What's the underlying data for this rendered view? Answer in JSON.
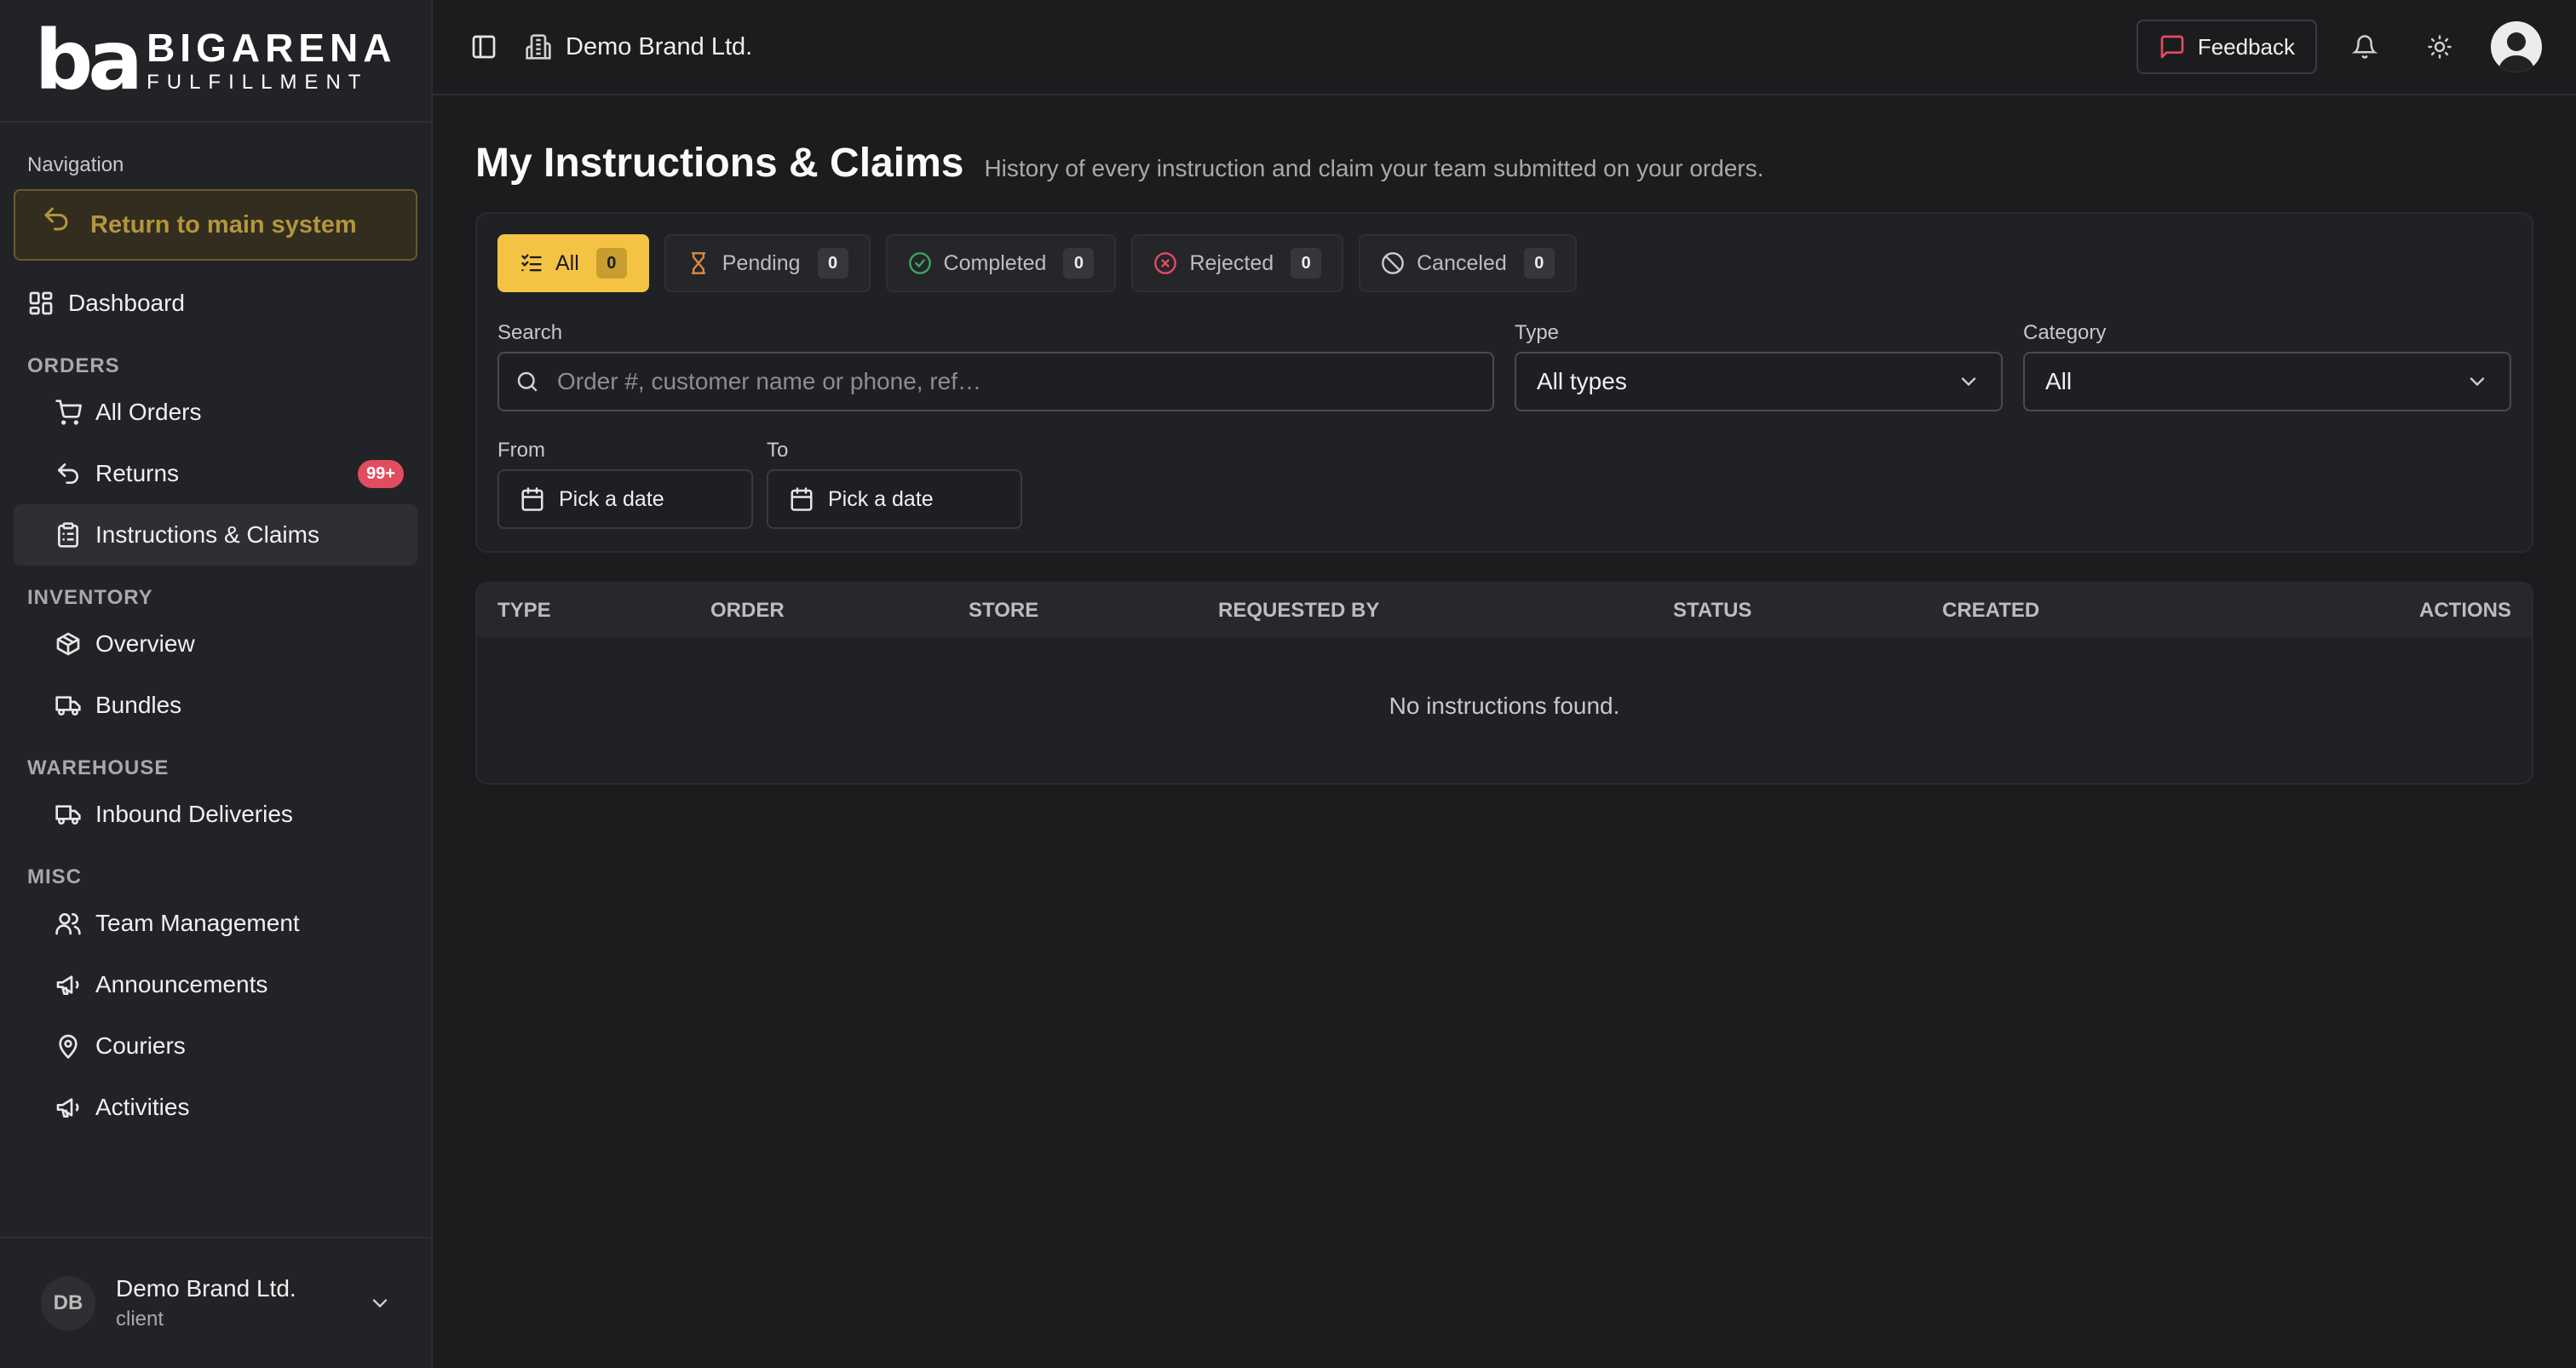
{
  "logo": {
    "mark": "ba",
    "main": "BIGARENA",
    "sub": "FULFILLMENT"
  },
  "sidebar": {
    "nav_label": "Navigation",
    "return_label": "Return to main system",
    "dashboard": "Dashboard",
    "sections": {
      "orders": "ORDERS",
      "inventory": "INVENTORY",
      "warehouse": "WAREHOUSE",
      "misc": "MISC"
    },
    "orders_items": [
      {
        "label": "All Orders"
      },
      {
        "label": "Returns",
        "badge": "99+"
      },
      {
        "label": "Instructions & Claims"
      }
    ],
    "inventory_items": [
      {
        "label": "Overview"
      },
      {
        "label": "Bundles"
      }
    ],
    "warehouse_items": [
      {
        "label": "Inbound Deliveries"
      }
    ],
    "misc_items": [
      {
        "label": "Team Management"
      },
      {
        "label": "Announcements"
      },
      {
        "label": "Couriers"
      },
      {
        "label": "Activities"
      }
    ],
    "user": {
      "initials": "DB",
      "name": "Demo Brand Ltd.",
      "role": "client"
    }
  },
  "topbar": {
    "brand": "Demo Brand Ltd.",
    "feedback_label": "Feedback"
  },
  "page": {
    "title": "My Instructions & Claims",
    "subtitle": "History of every instruction and claim your team submitted on your orders."
  },
  "tabs": [
    {
      "label": "All",
      "count": "0"
    },
    {
      "label": "Pending",
      "count": "0"
    },
    {
      "label": "Completed",
      "count": "0"
    },
    {
      "label": "Rejected",
      "count": "0"
    },
    {
      "label": "Canceled",
      "count": "0"
    }
  ],
  "filters": {
    "search_label": "Search",
    "search_placeholder": "Order #, customer name or phone, ref…",
    "type_label": "Type",
    "type_value": "All types",
    "category_label": "Category",
    "category_value": "All",
    "from_label": "From",
    "to_label": "To",
    "date_placeholder": "Pick a date"
  },
  "table": {
    "columns": [
      "TYPE",
      "ORDER",
      "STORE",
      "REQUESTED BY",
      "STATUS",
      "CREATED",
      "ACTIONS"
    ],
    "empty": "No instructions found."
  },
  "colors": {
    "accent": "#f5c344",
    "badge": "#e24c5f",
    "background": "#1b1c1e"
  }
}
